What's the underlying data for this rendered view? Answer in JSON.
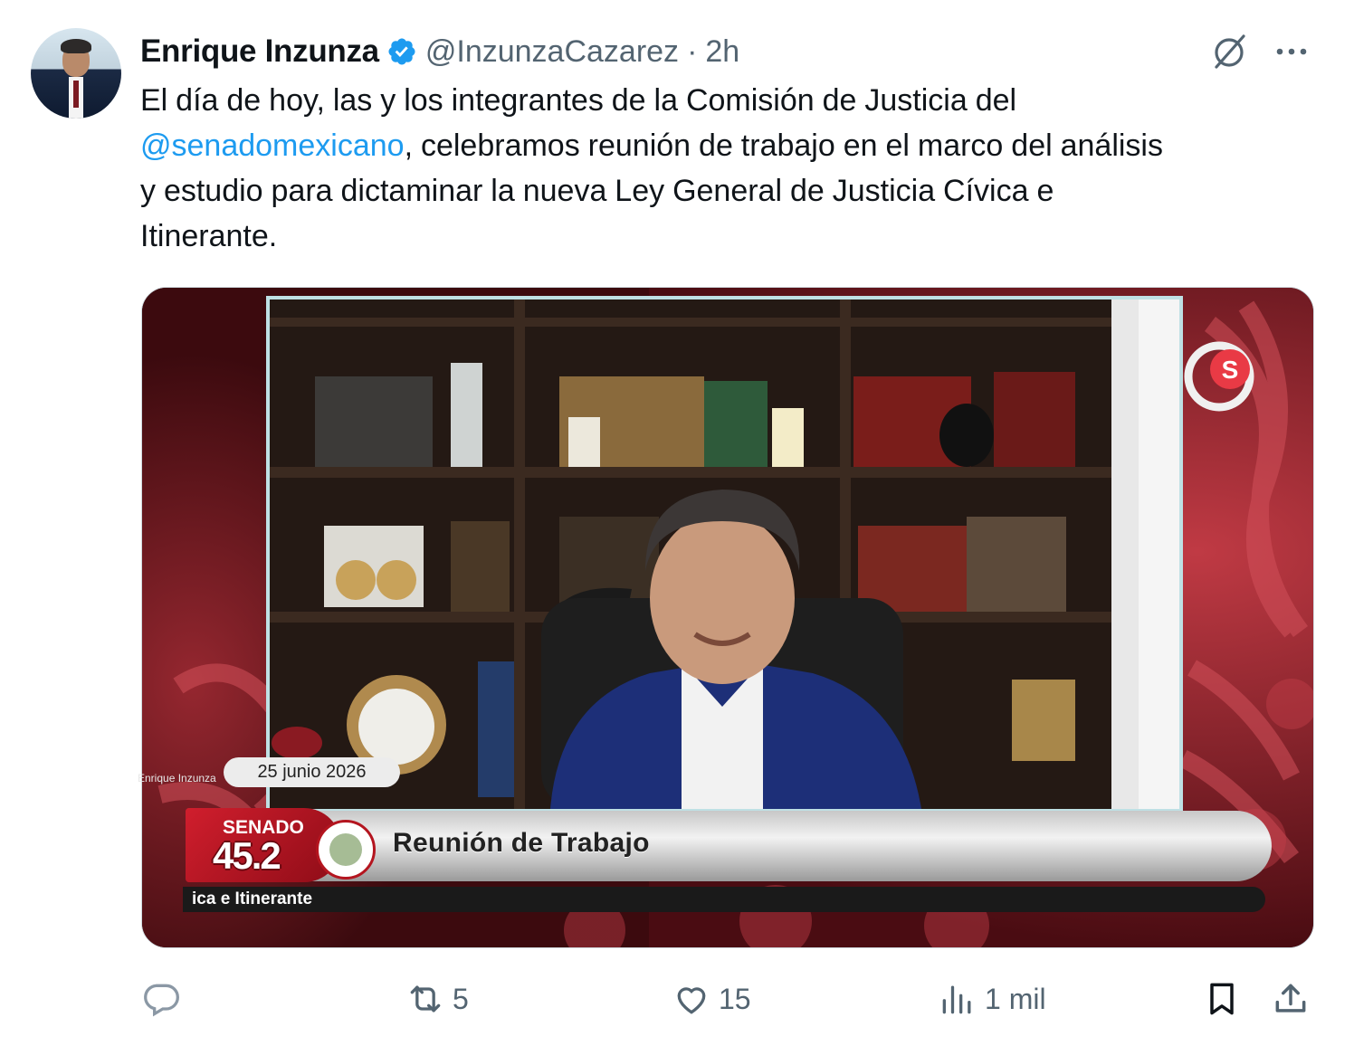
{
  "author": {
    "name": "Enrique Inzunza",
    "handle": "@InzunzaCazarez",
    "separator": "·",
    "time": "2h"
  },
  "post": {
    "text_before": "El día de hoy, las y los integrantes de la Comisión de Justicia del\n",
    "mention": "@senadomexicano",
    "text_after": ", celebramos reunión de trabajo en el marco del análisis\ny estudio para dictaminar la nueva Ley General de Justicia Cívica e\nItinerante."
  },
  "video": {
    "camera_label": "Enrique Inzunza",
    "date": "25 junio 2026",
    "channel_name": "SENADO",
    "channel_number": "45.2",
    "program_title": "Reunión de Trabajo",
    "ticker": "ica e Itinerante"
  },
  "actions": {
    "replies": "",
    "reposts": "5",
    "likes": "15",
    "views": "1 mil"
  },
  "icons": [
    "verified-badge-icon",
    "grok-icon",
    "more-icon",
    "reply-icon",
    "repost-icon",
    "like-icon",
    "views-icon",
    "bookmark-icon",
    "share-icon"
  ],
  "colors": {
    "accent": "#1d9bf0",
    "secondary_text": "#536471",
    "senado_red": "#c01a2a"
  }
}
